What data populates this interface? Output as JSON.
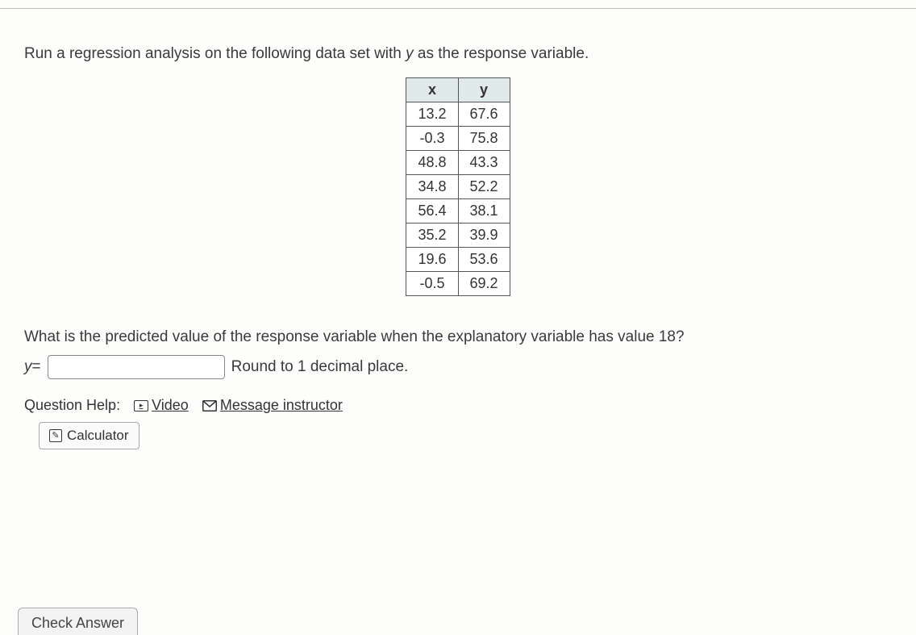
{
  "instruction_pre": "Run a regression analysis on the following data set with ",
  "instruction_var": "y",
  "instruction_post": " as the response variable.",
  "table": {
    "headers": [
      "x",
      "y"
    ],
    "rows": [
      [
        "13.2",
        "67.6"
      ],
      [
        "-0.3",
        "75.8"
      ],
      [
        "48.8",
        "43.3"
      ],
      [
        "34.8",
        "52.2"
      ],
      [
        "56.4",
        "38.1"
      ],
      [
        "35.2",
        "39.9"
      ],
      [
        "19.6",
        "53.6"
      ],
      [
        "-0.5",
        "69.2"
      ]
    ]
  },
  "question": "What is the predicted value of the response variable when the explanatory variable has value 18?",
  "answer": {
    "prefix_var": "y",
    "prefix_eq": " = ",
    "value": "",
    "hint": "Round to 1 decimal place."
  },
  "help": {
    "label": "Question Help:",
    "video": "Video",
    "message": "Message instructor",
    "calculator": "Calculator"
  },
  "check_answer": "Check Answer",
  "chart_data": {
    "type": "table",
    "columns": [
      "x",
      "y"
    ],
    "data": [
      {
        "x": 13.2,
        "y": 67.6
      },
      {
        "x": -0.3,
        "y": 75.8
      },
      {
        "x": 48.8,
        "y": 43.3
      },
      {
        "x": 34.8,
        "y": 52.2
      },
      {
        "x": 56.4,
        "y": 38.1
      },
      {
        "x": 35.2,
        "y": 39.9
      },
      {
        "x": 19.6,
        "y": 53.6
      },
      {
        "x": -0.5,
        "y": 69.2
      }
    ]
  }
}
